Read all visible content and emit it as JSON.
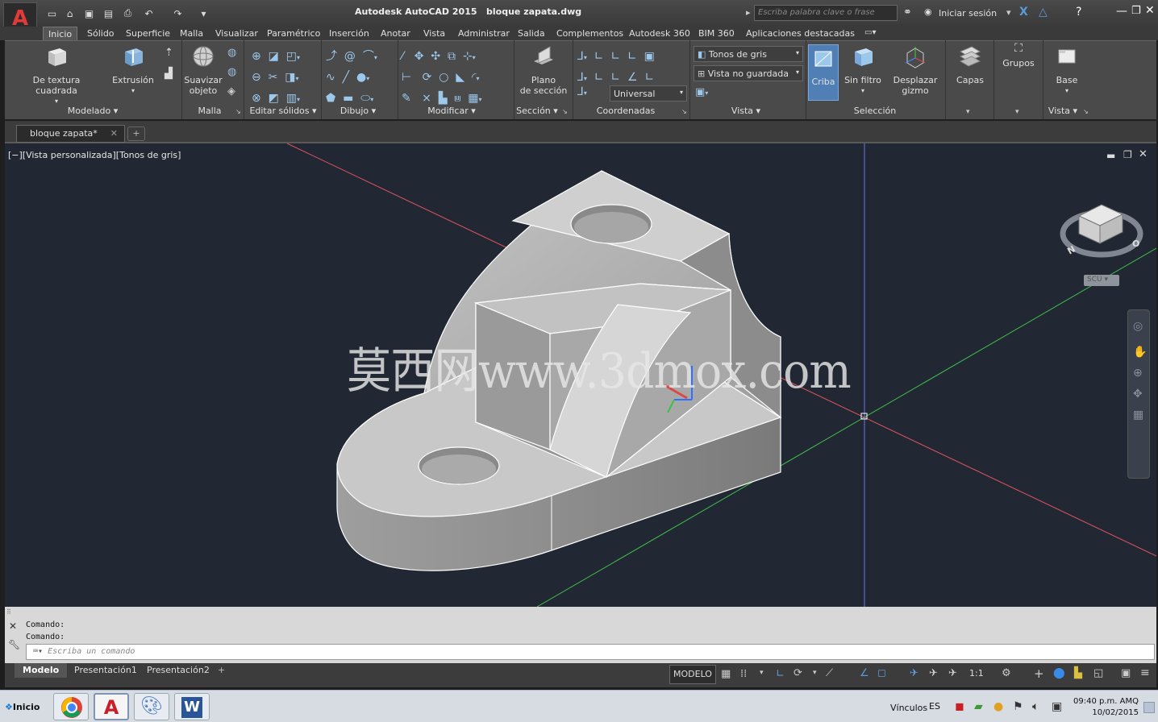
{
  "window": {
    "title": "Autodesk AutoCAD 2015",
    "filename": "bloque zapata.dwg",
    "search_placeholder": "Escriba palabra clave o frase",
    "signin": "Iniciar sesión"
  },
  "ribbon_tabs": [
    "Inicio",
    "Sólido",
    "Superficie",
    "Malla",
    "Visualizar",
    "Paramétrico",
    "Inserción",
    "Anotar",
    "Vista",
    "Administrar",
    "Salida",
    "Complementos",
    "Autodesk 360",
    "BIM 360",
    "Aplicaciones destacadas"
  ],
  "ribbon": {
    "modelado": {
      "label": "Modelado",
      "btn_textura": "De textura cuadrada",
      "btn_extrusion": "Extrusión"
    },
    "malla": {
      "label": "Malla",
      "btn_suavizar_1": "Suavizar",
      "btn_suavizar_2": "objeto"
    },
    "editar_solidos": {
      "label": "Editar sólidos"
    },
    "dibujo": {
      "label": "Dibujo"
    },
    "modificar": {
      "label": "Modificar"
    },
    "seccion": {
      "label": "Sección",
      "btn_plano_1": "Plano",
      "btn_plano_2": "de sección"
    },
    "coordenadas": {
      "label": "Coordenadas",
      "ucs_value": "Universal"
    },
    "vista": {
      "label": "Vista",
      "visual_style": "Tonos de gris",
      "named_view": "Vista no guardada"
    },
    "seleccion": {
      "label": "Selección",
      "btn_criba": "Criba",
      "btn_sinfiltro": "Sin filtro",
      "btn_gizmo_1": "Desplazar",
      "btn_gizmo_2": "gizmo"
    },
    "capas": {
      "btn_capas": "Capas"
    },
    "grupos": {
      "btn_grupos": "Grupos"
    },
    "vista2": {
      "label": "Vista",
      "btn_base": "Base"
    }
  },
  "document_tab": "bloque zapata*",
  "viewport": {
    "label": "[−][Vista personalizada][Tonos de gris]",
    "viewcube_n": "N",
    "viewcube_o": "O",
    "scu": "SCU"
  },
  "watermark": "莫西网www.3dmox.com",
  "command": {
    "history": [
      "Comando:",
      "Comando:"
    ],
    "placeholder": "Escriba un comando"
  },
  "layout_tabs": [
    "Modelo",
    "Presentación1",
    "Presentación2"
  ],
  "status": {
    "modelo": "MODELO",
    "scale": "1:1"
  },
  "taskbar": {
    "start": "Inicio",
    "vinculos": "Vínculos",
    "lang": "ES",
    "time": "09:40 p.m. AMQ",
    "date": "10/02/2015"
  },
  "colors": {
    "accent": "#3a6ea5",
    "viewport_bg": "#212733",
    "ribbon_bg": "#4a4a4a"
  }
}
